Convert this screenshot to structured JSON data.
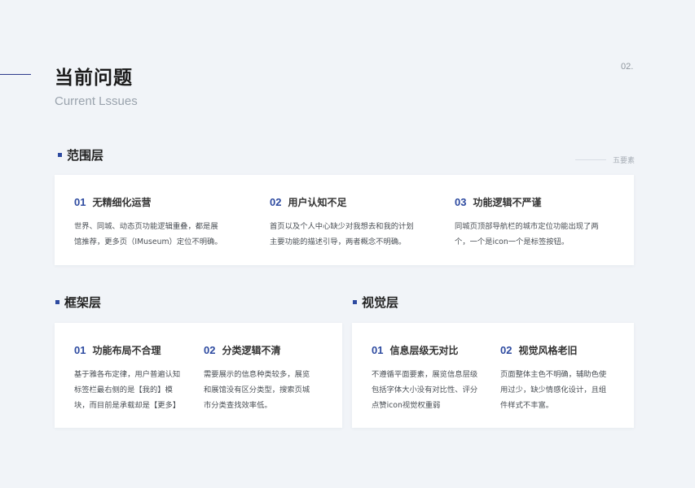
{
  "header": {
    "title": "当前问题",
    "subtitle": "Current Lssues",
    "page_number": "02."
  },
  "scope": {
    "heading": "范围层",
    "tag": "五要素",
    "items": [
      {
        "num": "01",
        "title": "无精细化运营",
        "desc": [
          "世界、同城、动态页功能逻辑重叠，都是展",
          "馆推荐，更多页（IMuseum）定位不明确。"
        ]
      },
      {
        "num": "02",
        "title": "用户认知不足",
        "desc": [
          "首页以及个人中心缺少对我想去和我的计划",
          "主要功能的描述引导，两者概念不明确。"
        ]
      },
      {
        "num": "03",
        "title": "功能逻辑不严谨",
        "desc": [
          "同城页顶部导航栏的城市定位功能出现了两",
          "个，一个是icon一个是标签按钮。"
        ]
      }
    ]
  },
  "framework": {
    "heading": "框架层",
    "items": [
      {
        "num": "01",
        "title": "功能布局不合理",
        "desc": [
          "基于雅各布定律，用户普遍认知",
          "标签栏最右侧的是【我的】模",
          "块，而目前是承载却是【更多】"
        ]
      },
      {
        "num": "02",
        "title": "分类逻辑不清",
        "desc": [
          "需要展示的信息种类较多，展览",
          "和展馆没有区分类型，搜索页城",
          "市分类查找效率低。"
        ]
      }
    ]
  },
  "visual": {
    "heading": "视觉层",
    "items": [
      {
        "num": "01",
        "title": "信息层级无对比",
        "desc": [
          "不遵循平面要素，展览信息层级",
          "包括字体大小没有对比性、评分",
          "点赞icon视觉权重弱"
        ]
      },
      {
        "num": "02",
        "title": "视觉风格老旧",
        "desc": [
          "页面整体主色不明确，辅助色使",
          "用过少，缺少情感化设计，且组",
          "件样式不丰富。"
        ]
      }
    ]
  }
}
